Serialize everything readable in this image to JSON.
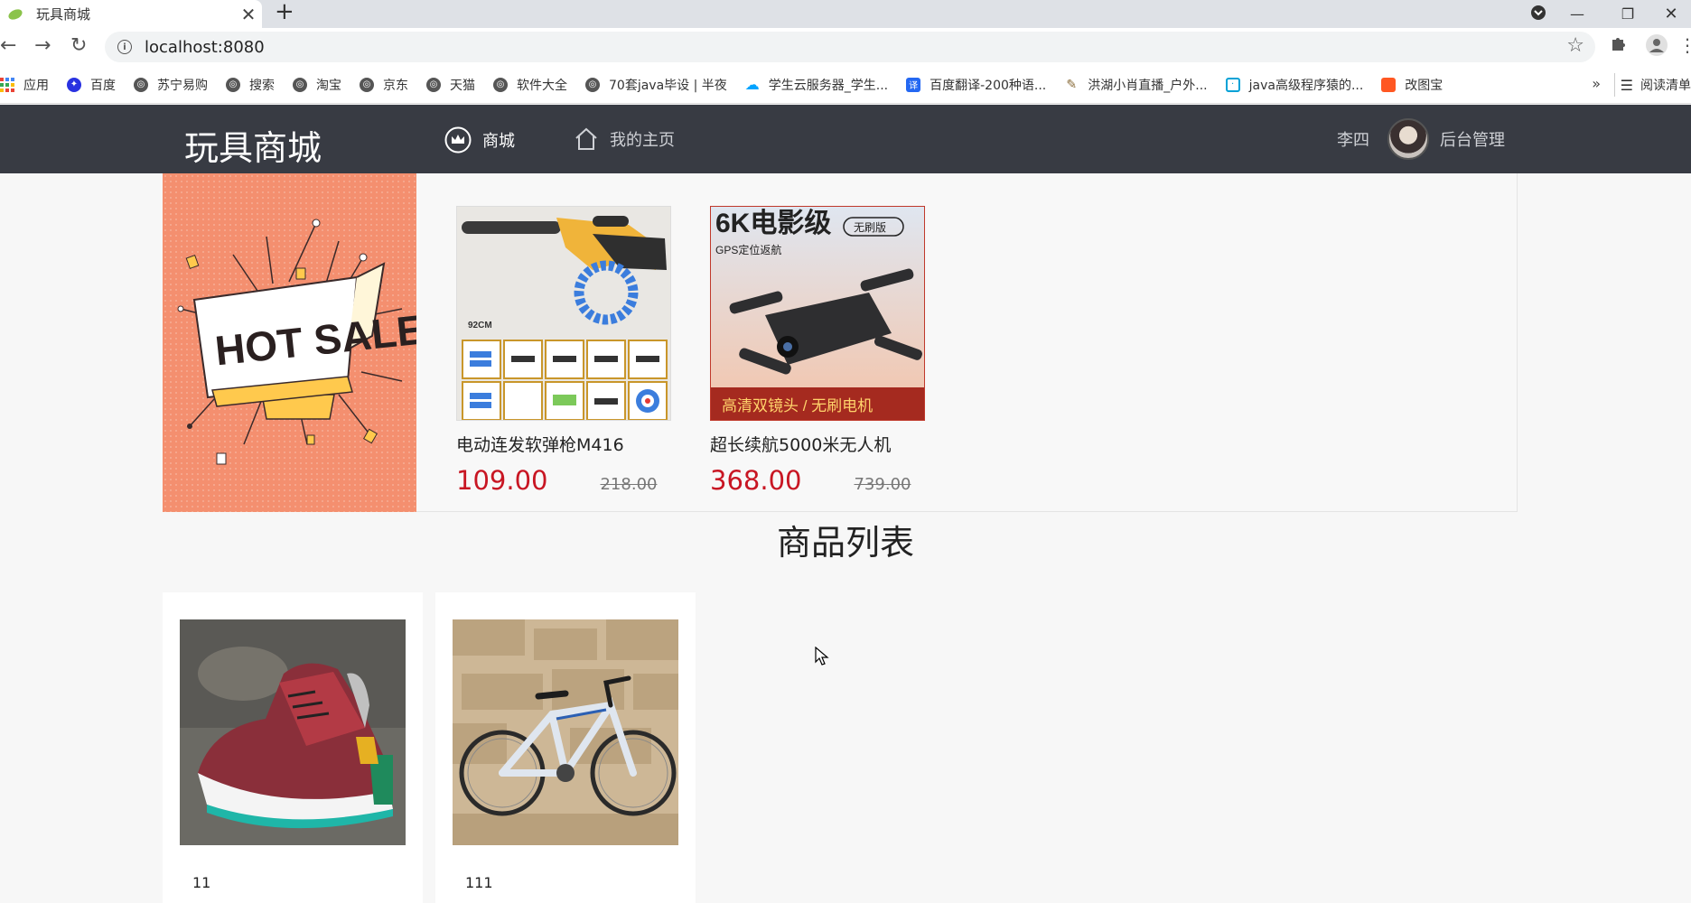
{
  "browser": {
    "tab_title": "玩具商城",
    "url": "localhost:8080",
    "bookmarks": [
      {
        "label": "应用",
        "icon": "apps-grid-icon",
        "color": "#4285f4"
      },
      {
        "label": "百度",
        "icon": "baidu-paw-icon",
        "color": "#2932e1"
      },
      {
        "label": "苏宁易购",
        "icon": "globe-icon",
        "color": "#555555"
      },
      {
        "label": "搜索",
        "icon": "globe-icon",
        "color": "#555555"
      },
      {
        "label": "淘宝",
        "icon": "globe-icon",
        "color": "#555555"
      },
      {
        "label": "京东",
        "icon": "globe-icon",
        "color": "#555555"
      },
      {
        "label": "天猫",
        "icon": "globe-icon",
        "color": "#555555"
      },
      {
        "label": "软件大全",
        "icon": "globe-icon",
        "color": "#555555"
      },
      {
        "label": "70套java毕设 | 半夜",
        "icon": "globe-icon",
        "color": "#555555"
      },
      {
        "label": "学生云服务器_学生...",
        "icon": "cloud-icon",
        "color": "#00a3ff"
      },
      {
        "label": "百度翻译-200种语...",
        "icon": "translate-icon",
        "color": "#2468f2"
      },
      {
        "label": "洪湖小肖直播_户外...",
        "icon": "feather-icon",
        "color": "#8a6d3b"
      },
      {
        "label": "java高级程序猿的...",
        "icon": "bilibili-icon",
        "color": "#00a1d6"
      },
      {
        "label": "改图宝",
        "icon": "photo-icon",
        "color": "#ff5722"
      }
    ],
    "more": "»",
    "reading_list": "阅读清单"
  },
  "header": {
    "brand": "玩具商城",
    "nav_shop": "商城",
    "nav_home": "我的主页",
    "username": "李四",
    "admin": "后台管理"
  },
  "hot": {
    "banner_text": "HOT SALE",
    "items": [
      {
        "name": "电动连发软弹枪M416",
        "price": "109.00",
        "old_price": "218.00",
        "label": "92CM"
      },
      {
        "name": "超长续航5000米无人机",
        "price": "368.00",
        "old_price": "739.00",
        "label": "6K电影级",
        "badge": "无刷版",
        "sub": "GPS定位返航",
        "bottom": "高清双镜头 / 无刷电机"
      }
    ]
  },
  "list": {
    "title": "商品列表",
    "items": [
      {
        "name": "11"
      },
      {
        "name": "111"
      }
    ]
  },
  "colors": {
    "header_bg": "#383b43",
    "price_red": "#c81623",
    "banner_bg": "#f48f6f"
  }
}
